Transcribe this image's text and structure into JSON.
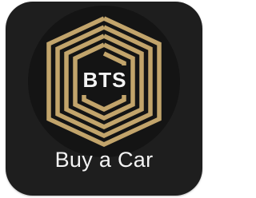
{
  "app": {
    "badge_text": "BTS",
    "caption": "Buy a Car"
  },
  "colors": {
    "tile_background": "#1e1e1e",
    "circle_background": "#141414",
    "gold": "#c2a46b",
    "text": "#f4f4f4"
  },
  "icons": {
    "logo": "bts-hexagon-logo-icon"
  }
}
